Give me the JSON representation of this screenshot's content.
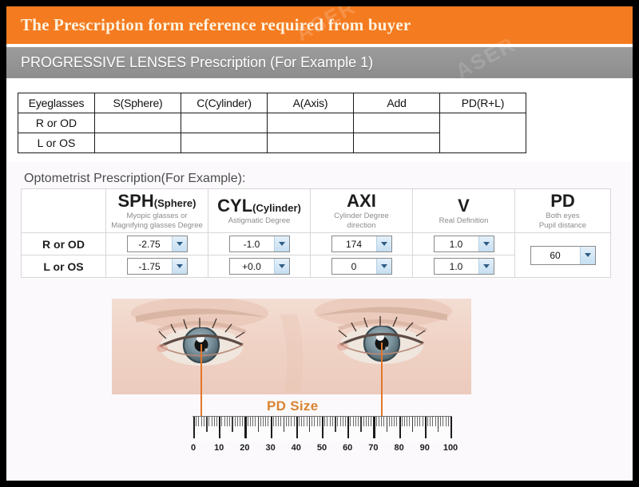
{
  "header": {
    "title": "The Prescription form reference required from buyer",
    "subtitle": "PROGRESSIVE LENSES Prescription (For Example 1)",
    "orange_color": "#f47b20",
    "gray_color": "#949494"
  },
  "blank_table": {
    "columns": [
      "Eyeglasses",
      "S(Sphere)",
      "C(Cylinder)",
      "A(Axis)",
      "Add",
      "PD(R+L)"
    ],
    "rows": [
      {
        "label": "R or OD",
        "values": [
          "",
          "",
          "",
          ""
        ]
      },
      {
        "label": "L or OS",
        "values": [
          "",
          "",
          "",
          ""
        ]
      }
    ],
    "pd_merged_value": ""
  },
  "example_table": {
    "caption": "Optometrist Prescription(For Example):",
    "columns": [
      {
        "abbr": "",
        "paren": "",
        "desc": ""
      },
      {
        "abbr": "SPH",
        "paren": "(Sphere)",
        "desc": "Myopic glasses or\nMagnifying glasses Degree"
      },
      {
        "abbr": "CYL",
        "paren": "(Cylinder)",
        "desc": "Astigmatic  Degree"
      },
      {
        "abbr": "AXI",
        "paren": "",
        "desc": "Cylinder Degree\ndirection"
      },
      {
        "abbr": "V",
        "paren": "",
        "desc": "Real Definition"
      },
      {
        "abbr": "PD",
        "paren": "",
        "desc": "Both eyes\nPupil distance"
      }
    ],
    "rows": [
      {
        "label": "R or OD",
        "sph": "-2.75",
        "cyl": "-1.0",
        "axi": "174",
        "v": "1.0"
      },
      {
        "label": "L or OS",
        "sph": "-1.75",
        "cyl": "+0.0",
        "axi": "0",
        "v": "1.0"
      }
    ],
    "pd_value": "60"
  },
  "illustration": {
    "pd_size_label": "PD Size",
    "ruler": {
      "labels": [
        "0",
        "10",
        "20",
        "30",
        "40",
        "50",
        "60",
        "70",
        "80",
        "90",
        "100"
      ],
      "min": 0,
      "max": 100,
      "unit_step": 10
    },
    "guide_color": "#e2762b"
  },
  "watermark": {
    "text": "ASER"
  }
}
